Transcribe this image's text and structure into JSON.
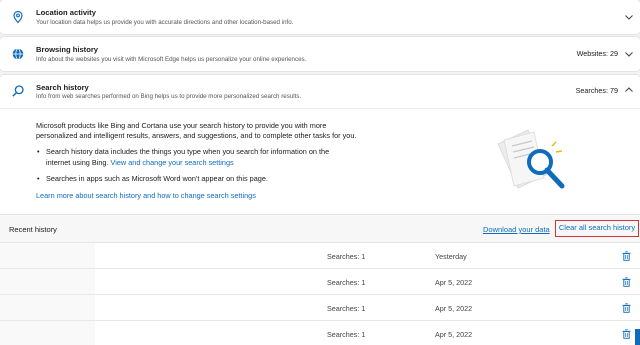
{
  "location": {
    "title": "Location activity",
    "description": "Your location data helps us provide you with accurate directions and other location-based info."
  },
  "browsing": {
    "title": "Browsing history",
    "description": "Info about the websites you visit with Microsoft Edge helps us personalize your online experiences.",
    "count": "Websites: 29"
  },
  "search": {
    "title": "Search history",
    "description": "Info from web searches performed on Bing helps us to provide more personalized search results.",
    "count": "Searches: 79",
    "intro_line1": "Microsoft products like Bing and Cortana use your search history to provide you with more",
    "intro_line2": "personalized and intelligent results, answers, and suggestions, and to complete other tasks for you.",
    "bullet1_line1": "Search history data includes the things you type when you search for information on the",
    "bullet1_line2_text": "internet using Bing. ",
    "bullet1_link": "View and change your search settings",
    "bullet2": "Searches in apps such as Microsoft Word won't appear on this page.",
    "learn_more": "Learn more about search history and how to change search settings"
  },
  "recent": {
    "title": "Recent history",
    "download_label": "Download your data",
    "clear_label": "Clear all search history",
    "rows": [
      {
        "searches": "Searches: 1",
        "date": "Yesterday"
      },
      {
        "searches": "Searches: 1",
        "date": "Apr 5, 2022"
      },
      {
        "searches": "Searches: 1",
        "date": "Apr 5, 2022"
      },
      {
        "searches": "Searches: 1",
        "date": "Apr 5, 2022"
      }
    ]
  },
  "colors": {
    "accent": "#0f6cbd",
    "highlight_border": "#d13438"
  }
}
